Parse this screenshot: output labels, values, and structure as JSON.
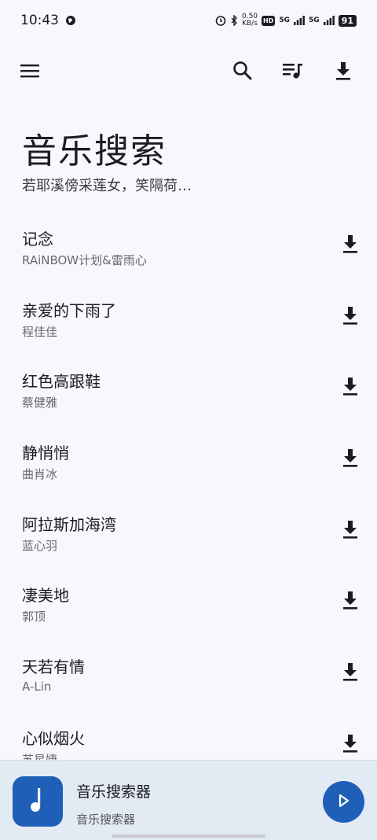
{
  "status": {
    "time": "10:43",
    "net_speed_value": "0.50",
    "net_speed_unit": "KB/s",
    "hd": "HD",
    "sim1": "5G",
    "sim2": "5G",
    "battery": "91"
  },
  "toolbar": {
    "menu_icon": "menu-icon",
    "search_icon": "search-icon",
    "playlist_icon": "playlist-icon",
    "download_icon": "download-icon"
  },
  "header": {
    "title": "音乐搜索",
    "subtitle": "若耶溪傍采莲女，笑隔荷…"
  },
  "songs": [
    {
      "title": "记念",
      "artist": "RAiNBOW计划&雷雨心"
    },
    {
      "title": "亲爱的下雨了",
      "artist": "程佳佳"
    },
    {
      "title": "红色高跟鞋",
      "artist": "蔡健雅"
    },
    {
      "title": "静悄悄",
      "artist": "曲肖冰"
    },
    {
      "title": "阿拉斯加海湾",
      "artist": "蓝心羽"
    },
    {
      "title": "凄美地",
      "artist": "郭顶"
    },
    {
      "title": "天若有情",
      "artist": "A-Lin"
    },
    {
      "title": "心似烟火",
      "artist": "苏星婕"
    }
  ],
  "player": {
    "title": "音乐搜索器",
    "subtitle": "音乐搜索器",
    "accent_color": "#1f5fb8"
  }
}
